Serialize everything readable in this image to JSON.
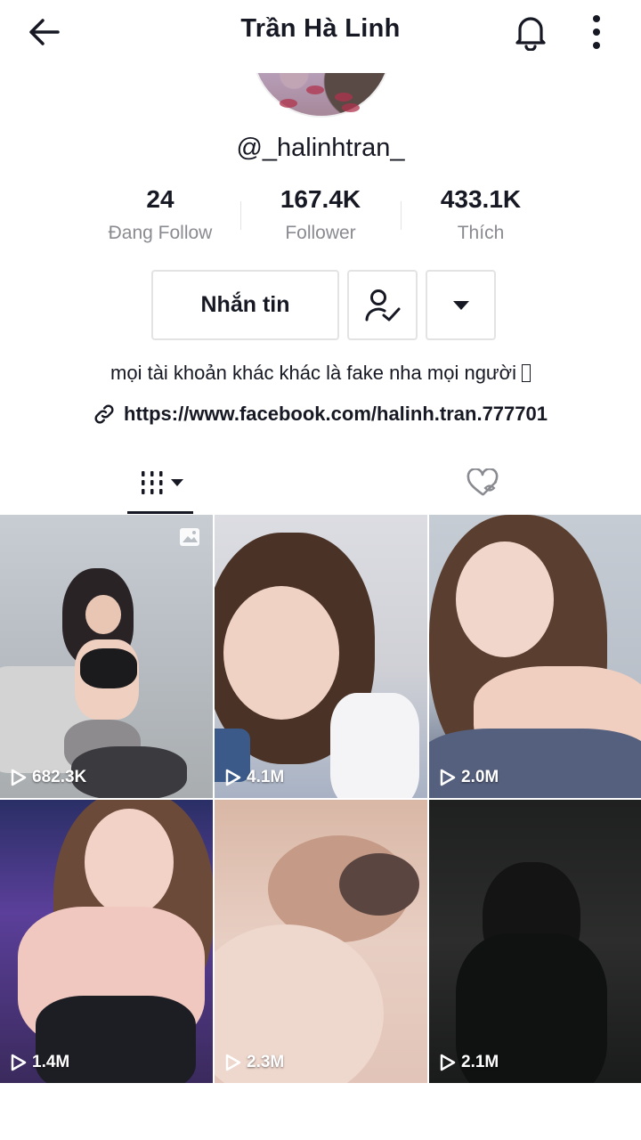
{
  "header": {
    "title": "Trần Hà Linh"
  },
  "profile": {
    "username": "@_halinhtran_",
    "stats": [
      {
        "value": "24",
        "label": "Đang Follow"
      },
      {
        "value": "167.4K",
        "label": "Follower"
      },
      {
        "value": "433.1K",
        "label": "Thích"
      }
    ],
    "actions": {
      "message_label": "Nhắn tin"
    },
    "bio": "mọi tài khoản khác khác là fake nha mọi người",
    "link": "https://www.facebook.com/halinh.tran.777701"
  },
  "icons": {
    "back": "back-arrow-icon",
    "bell": "bell-icon",
    "more": "more-vertical-icon",
    "friends": "user-check-icon",
    "dropdown": "caret-down-icon",
    "link": "link-icon",
    "videos_tab": "grid-icon",
    "liked_tab": "heart-hidden-icon",
    "play": "play-icon",
    "photo": "photo-icon"
  },
  "videos": [
    {
      "views": "682.3K",
      "is_photo": true
    },
    {
      "views": "4.1M",
      "is_photo": false
    },
    {
      "views": "2.0M",
      "is_photo": false
    },
    {
      "views": "1.4M",
      "is_photo": false
    },
    {
      "views": "2.3M",
      "is_photo": false
    },
    {
      "views": "2.1M",
      "is_photo": false
    }
  ],
  "colors": {
    "text": "#161823",
    "secondary_text": "#8a8b91",
    "border": "#e3e3e4"
  }
}
